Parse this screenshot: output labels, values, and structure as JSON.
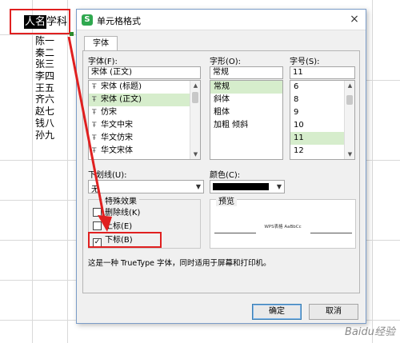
{
  "sheet": {
    "header_selected": "人名",
    "header_normal": "学科",
    "names": [
      "陈一",
      "秦二",
      "张三",
      "李四",
      "王五",
      "齐六",
      "赵七",
      "钱八",
      "孙九"
    ]
  },
  "dialog": {
    "title": "单元格格式",
    "close_glyph": "×",
    "tab_font": "字体",
    "font_label": "字体(F):",
    "font_value": "宋体 (正文)",
    "font_list": [
      {
        "label": "宋体 (标题)",
        "selected": false
      },
      {
        "label": "宋体 (正文)",
        "selected": true
      },
      {
        "label": "仿宋",
        "selected": false
      },
      {
        "label": "华文中宋",
        "selected": false
      },
      {
        "label": "华文仿宋",
        "selected": false
      },
      {
        "label": "华文宋体",
        "selected": false
      }
    ],
    "style_label": "字形(O):",
    "style_value": "常规",
    "style_list": [
      {
        "label": "常规",
        "selected": true
      },
      {
        "label": "斜体",
        "selected": false
      },
      {
        "label": "粗体",
        "selected": false
      },
      {
        "label": "加粗 倾斜",
        "selected": false
      }
    ],
    "size_label": "字号(S):",
    "size_value": "11",
    "size_list": [
      {
        "label": "6",
        "selected": false
      },
      {
        "label": "8",
        "selected": false
      },
      {
        "label": "9",
        "selected": false
      },
      {
        "label": "10",
        "selected": false
      },
      {
        "label": "11",
        "selected": true
      },
      {
        "label": "12",
        "selected": false
      }
    ],
    "underline_label": "下划线(U):",
    "underline_value": "无",
    "color_label": "颜色(C):",
    "effects_title": "特殊效果",
    "effects": [
      {
        "label": "删除线(K)",
        "checked": false
      },
      {
        "label": "上标(E)",
        "checked": false
      },
      {
        "label": "下标(B)",
        "checked": true
      }
    ],
    "preview_title": "预览",
    "preview_text": "WPS表格  AaBbCc",
    "description": "这是一种 TrueType 字体，同时适用于屏幕和打印机。",
    "ok_label": "确定",
    "cancel_label": "取消",
    "check_glyph": "✓",
    "font_glyph": "Ŧ"
  },
  "colors": {
    "accent_red": "#e02020",
    "selection_green": "#d6edcc",
    "icon_green": "#2fa84f"
  },
  "watermark": "Baidu经验"
}
